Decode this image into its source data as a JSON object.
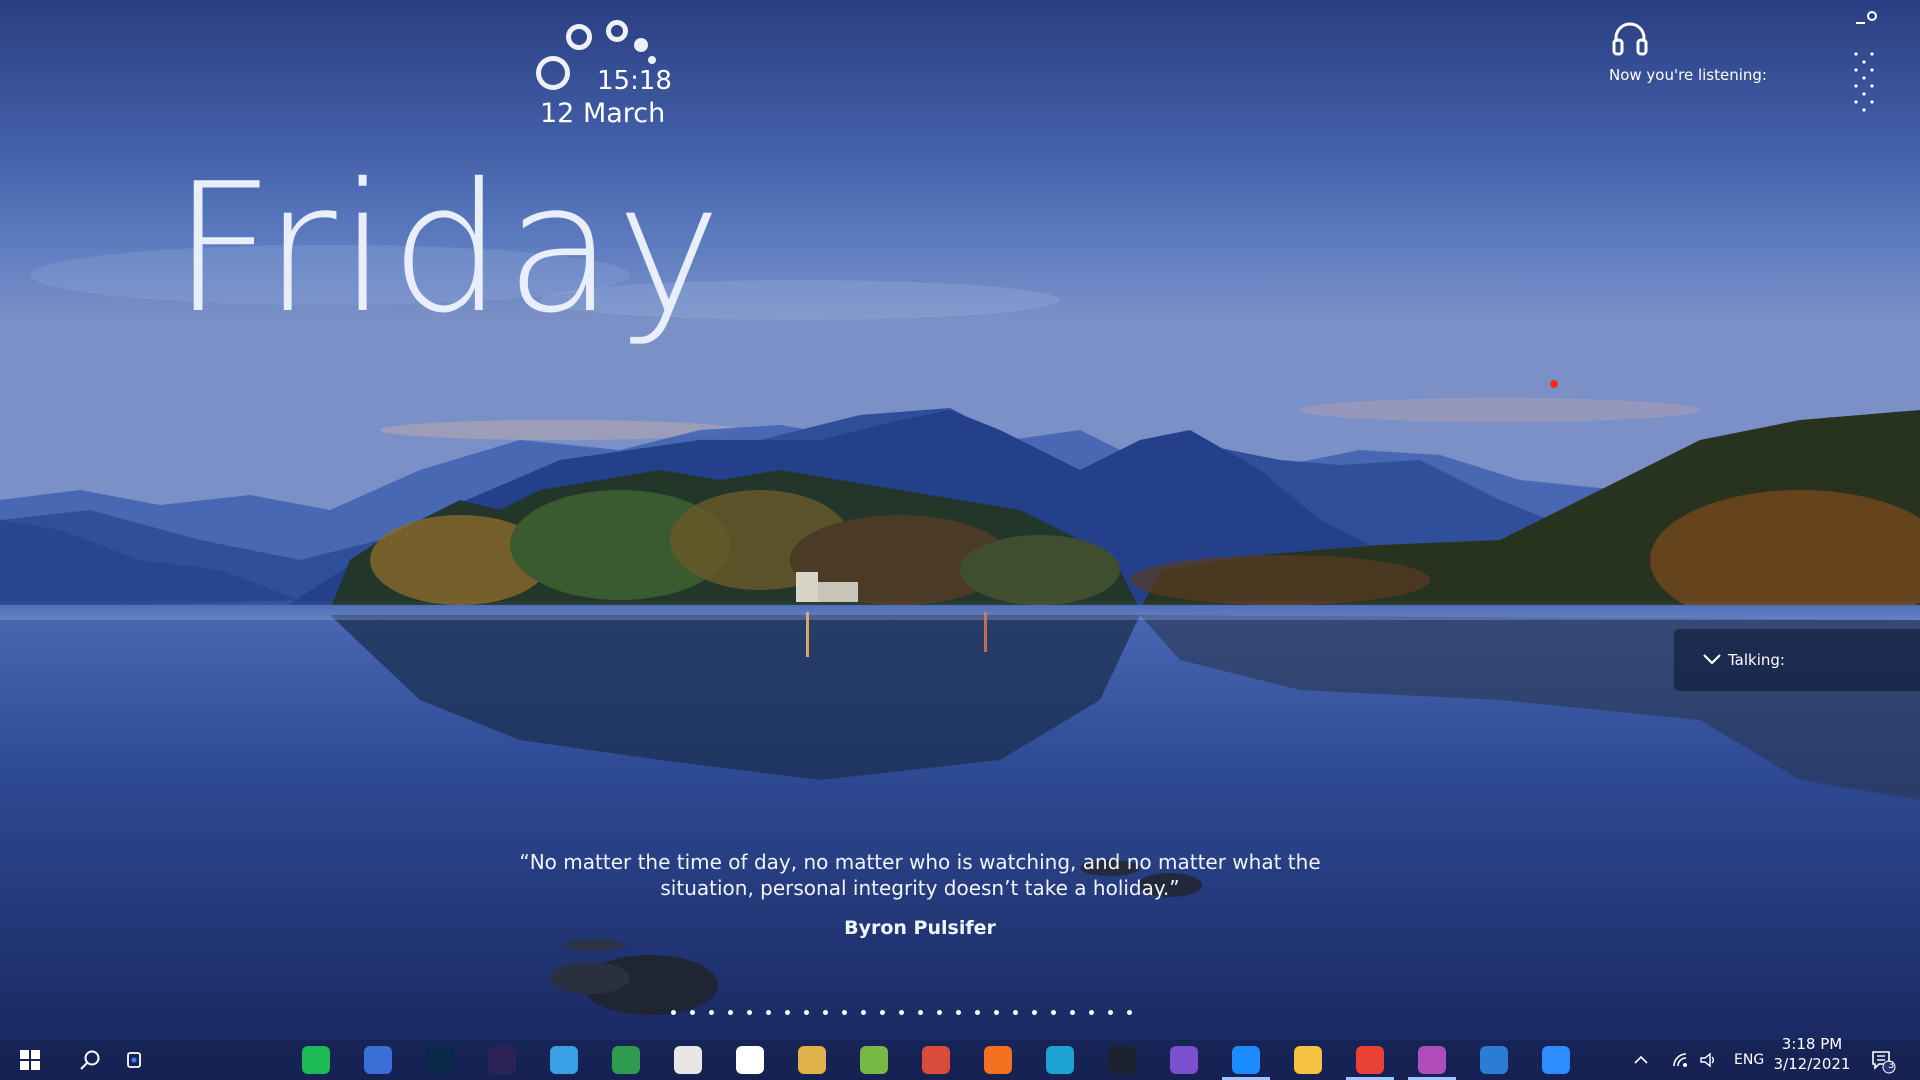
{
  "clock": {
    "time": "15:18",
    "date": "12 March",
    "day": "Friday"
  },
  "music": {
    "label": "Now you're listening:",
    "icon": "headphones-icon"
  },
  "talking": {
    "label": "Talking:",
    "icon": "chevron-down-icon"
  },
  "quote": {
    "text": "“No matter the time of day, no matter who is watching, and no matter what the situation, personal integrity doesn’t take a holiday.”",
    "author": "Byron Pulsifer"
  },
  "pager": {
    "page_count": 25
  },
  "taskbar": {
    "start_icon": "windows-start-icon",
    "search_icon": "search-icon",
    "apps": [
      {
        "name": "spotify",
        "color": "#1db954",
        "active": false
      },
      {
        "name": "intellij",
        "color": "#3b6fd8",
        "active": false
      },
      {
        "name": "photoshop",
        "color": "#0a2a4a",
        "active": false
      },
      {
        "name": "eclipse",
        "color": "#2c2255",
        "active": false
      },
      {
        "name": "vscode-like",
        "color": "#3aa0e6",
        "active": false
      },
      {
        "name": "geogebra-like",
        "color": "#2f9b4f",
        "active": false
      },
      {
        "name": "sql-tool",
        "color": "#e7e7e7",
        "active": false
      },
      {
        "name": "lambda-tool",
        "color": "#ffffff",
        "active": false
      },
      {
        "name": "build-tools",
        "color": "#e0b24a",
        "active": false
      },
      {
        "name": "layers-app",
        "color": "#77b943",
        "active": false
      },
      {
        "name": "tools-app",
        "color": "#d94b3b",
        "active": false
      },
      {
        "name": "xampp",
        "color": "#f37021",
        "active": false
      },
      {
        "name": "edge",
        "color": "#1fa3d7",
        "active": false
      },
      {
        "name": "dark-app",
        "color": "#1c2230",
        "active": false
      },
      {
        "name": "visual-studio",
        "color": "#7b4fd0",
        "active": false
      },
      {
        "name": "zalo",
        "color": "#1a8cff",
        "active": true
      },
      {
        "name": "file-explorer",
        "color": "#f4c140",
        "active": false
      },
      {
        "name": "chrome",
        "color": "#e94235",
        "active": true
      },
      {
        "name": "phpstorm",
        "color": "#b04dbb",
        "active": true
      },
      {
        "name": "word-like",
        "color": "#2b7cd3",
        "active": false
      },
      {
        "name": "zoom",
        "color": "#2d8cff",
        "active": false
      }
    ],
    "tray": {
      "language": "ENG",
      "time": "3:18 PM",
      "date": "3/12/2021",
      "notification_count": "3"
    }
  },
  "colors": {
    "accent": "#9fc4ff",
    "recording_dot": "#ff2a1a"
  }
}
